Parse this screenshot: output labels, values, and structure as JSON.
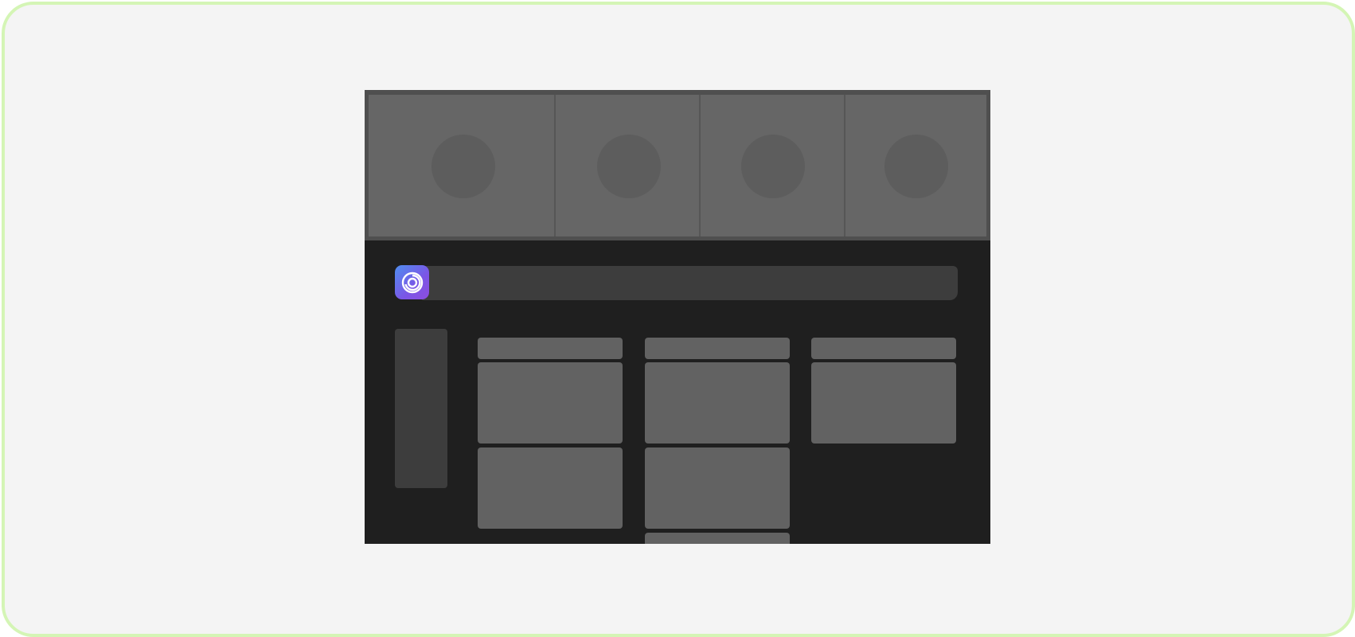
{
  "app": {
    "icon": "spiral-logo-icon",
    "search_value": ""
  },
  "colors": {
    "frame_border": "#d4f5b5",
    "background": "#f4f4f4",
    "window_bg": "#1f1f1f",
    "thumbnail": "#666666",
    "panel": "#3d3d3d",
    "card": "#626262",
    "icon_gradient_start": "#4f8ef0",
    "icon_gradient_end": "#8d4de0"
  },
  "thumbnails": [
    {
      "icon": "image-placeholder-icon"
    },
    {
      "icon": "image-placeholder-icon"
    },
    {
      "icon": "image-placeholder-icon"
    },
    {
      "icon": "image-placeholder-icon"
    }
  ],
  "columns": [
    {
      "cards": 2
    },
    {
      "cards": 3
    },
    {
      "cards": 1
    }
  ]
}
